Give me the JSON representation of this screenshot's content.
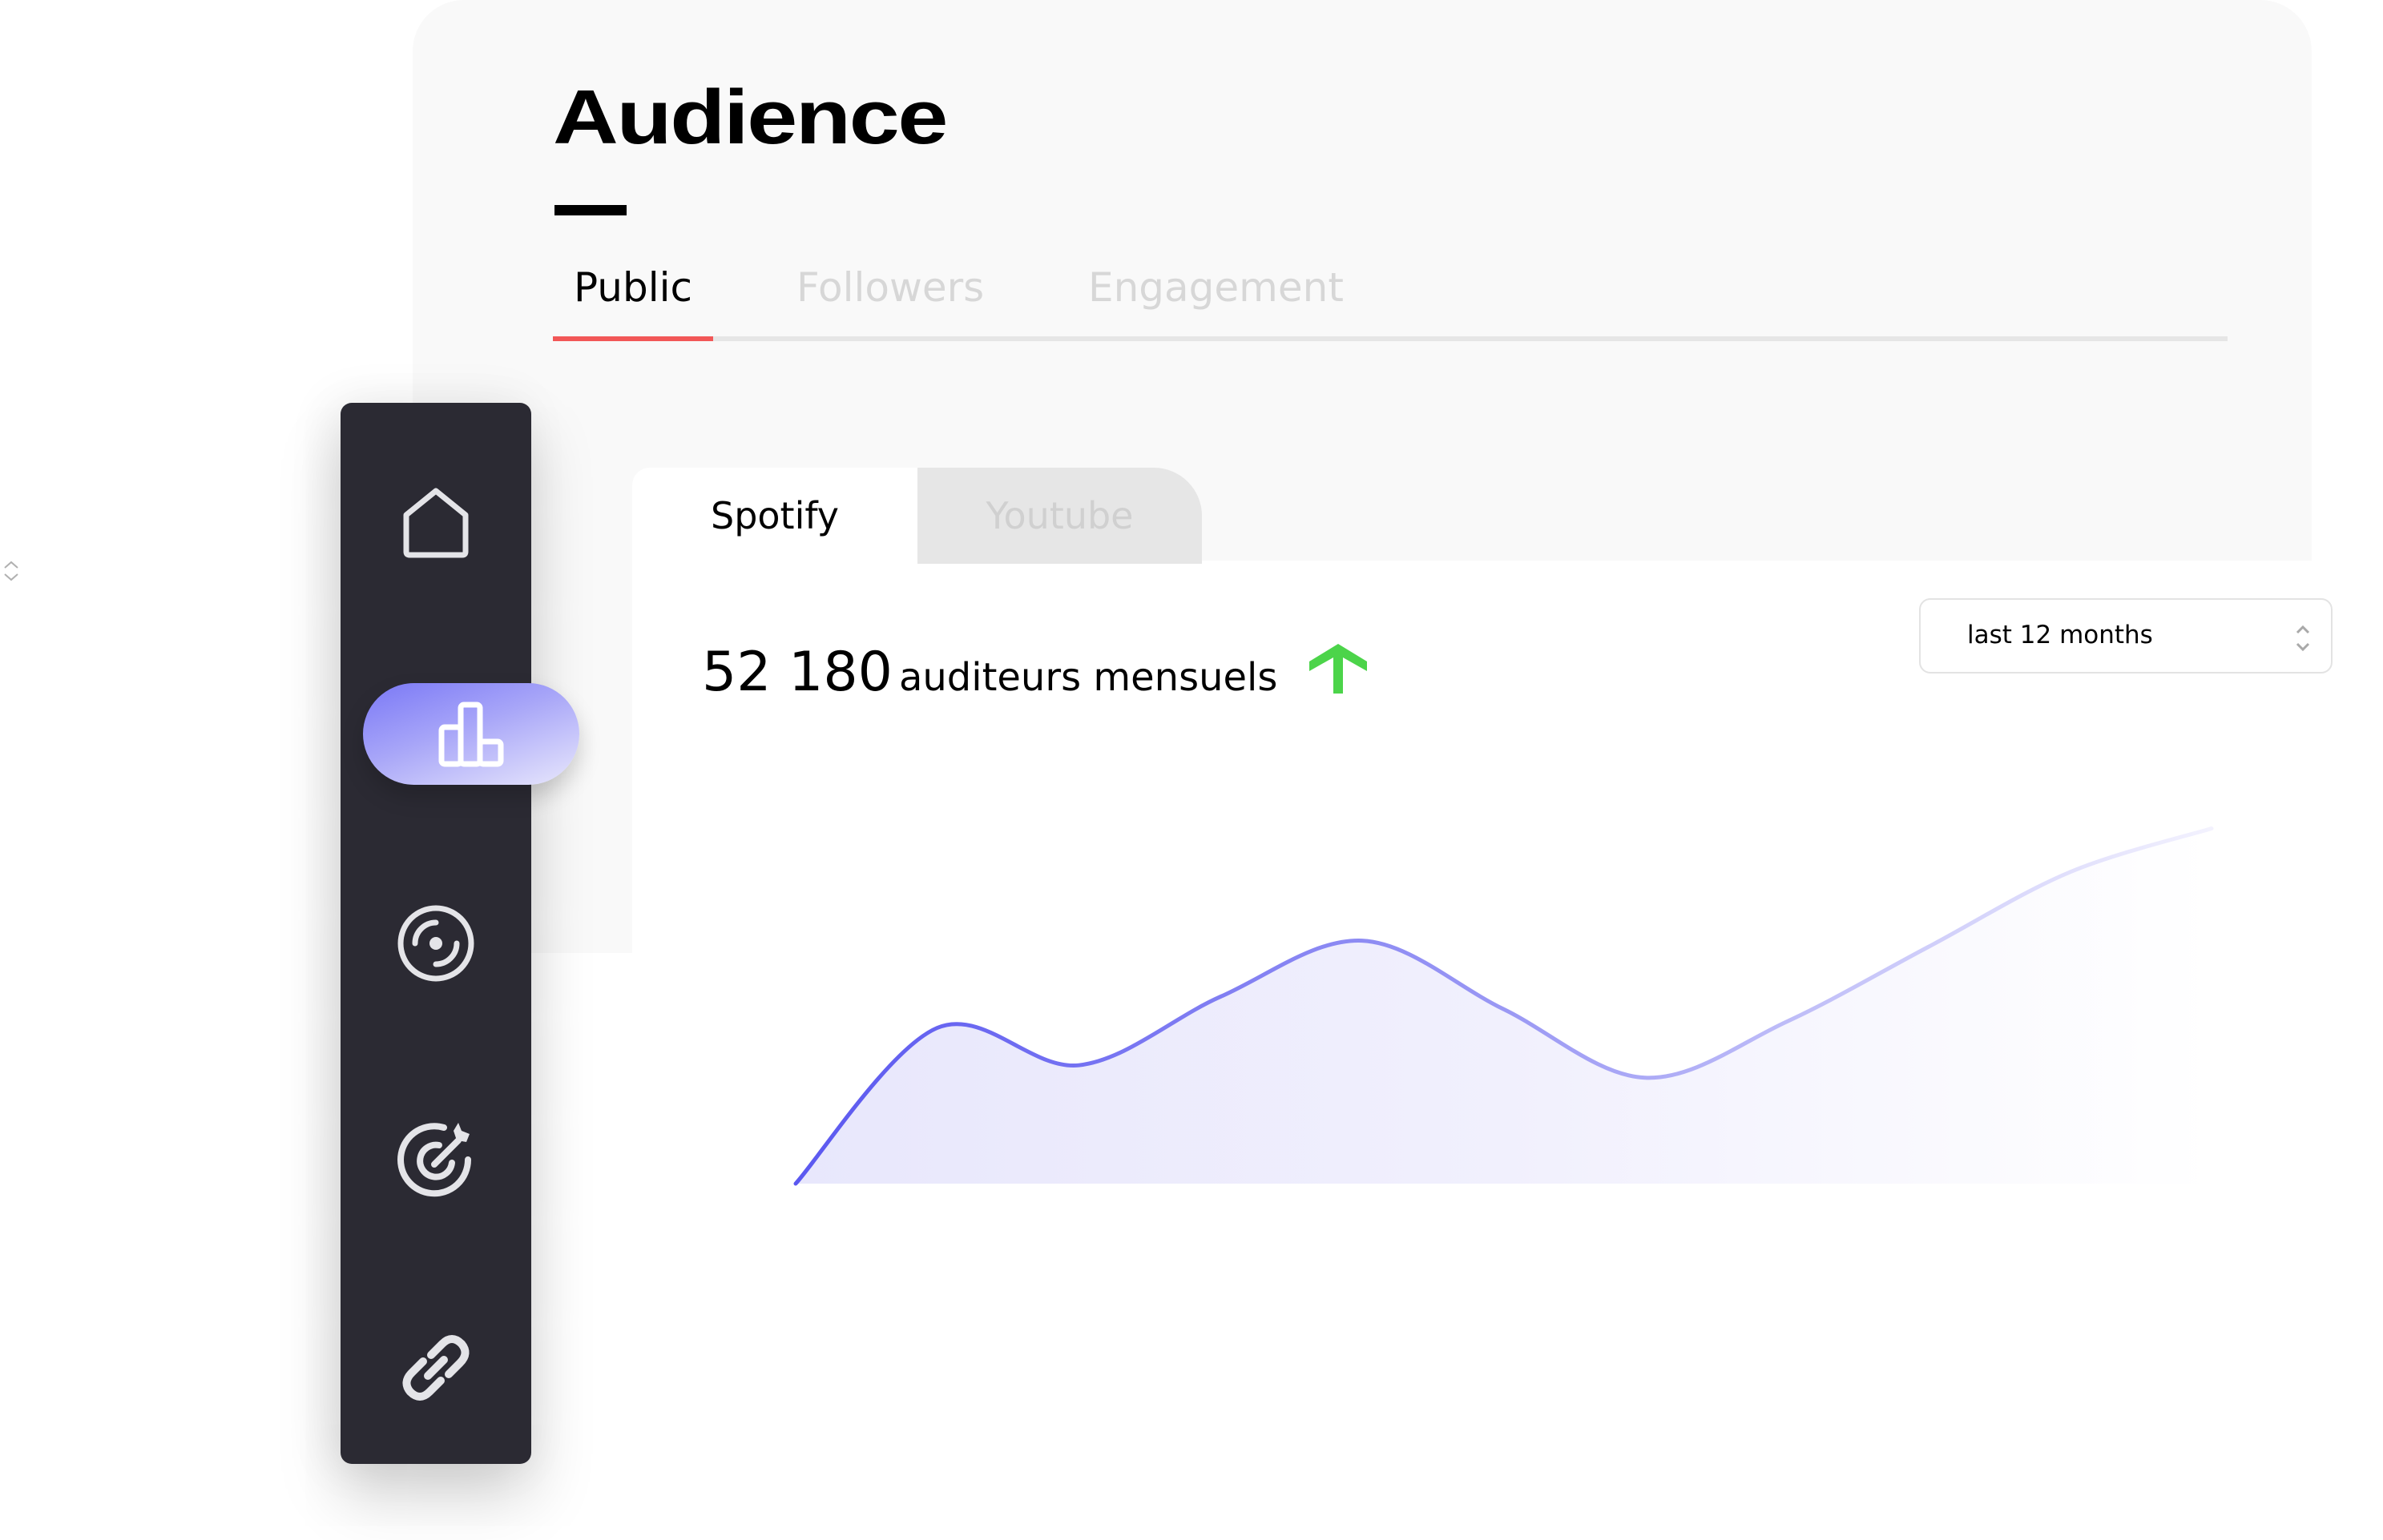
{
  "page": {
    "title": "Audience"
  },
  "tabs": [
    {
      "label": "Public",
      "active": true
    },
    {
      "label": "Followers",
      "active": false
    },
    {
      "label": "Engagement",
      "active": false
    }
  ],
  "platform_tabs": [
    {
      "label": "Spotify",
      "active": true
    },
    {
      "label": "Youtube",
      "active": false
    }
  ],
  "metric": {
    "value": "52 180",
    "label": "auditeurs mensuels",
    "trend": "up",
    "trend_icon": "arrow-up-icon"
  },
  "range_select": {
    "value": "last 12 months",
    "icon": "chevron-up-down-icon"
  },
  "sidebar": {
    "items": [
      {
        "name": "home",
        "icon": "home-icon",
        "active": false
      },
      {
        "name": "audience",
        "icon": "bar-chart-icon",
        "active": true
      },
      {
        "name": "music",
        "icon": "disc-icon",
        "active": false
      },
      {
        "name": "goals",
        "icon": "target-arrow-icon",
        "active": false
      },
      {
        "name": "links",
        "icon": "link-icon",
        "active": false
      }
    ]
  },
  "colors": {
    "accent": "#5b58f0",
    "tab_indicator": "#f25757",
    "trend_up": "#4cd44a",
    "sidebar_bg": "#2b2a33",
    "card_bg": "#f9f9f9"
  },
  "chart_data": {
    "type": "area",
    "title": "",
    "xlabel": "",
    "ylabel": "",
    "note": "decorative trend curve, no axes or labels; values are relative (0-100) estimates of curve shape",
    "x": [
      0,
      1,
      2,
      3,
      4,
      5,
      6,
      7,
      8,
      9,
      10
    ],
    "values": [
      0,
      25,
      19,
      30,
      39,
      28,
      17,
      26,
      38,
      50,
      57
    ],
    "ylim": [
      0,
      100
    ],
    "grid": false,
    "legend": "none"
  }
}
